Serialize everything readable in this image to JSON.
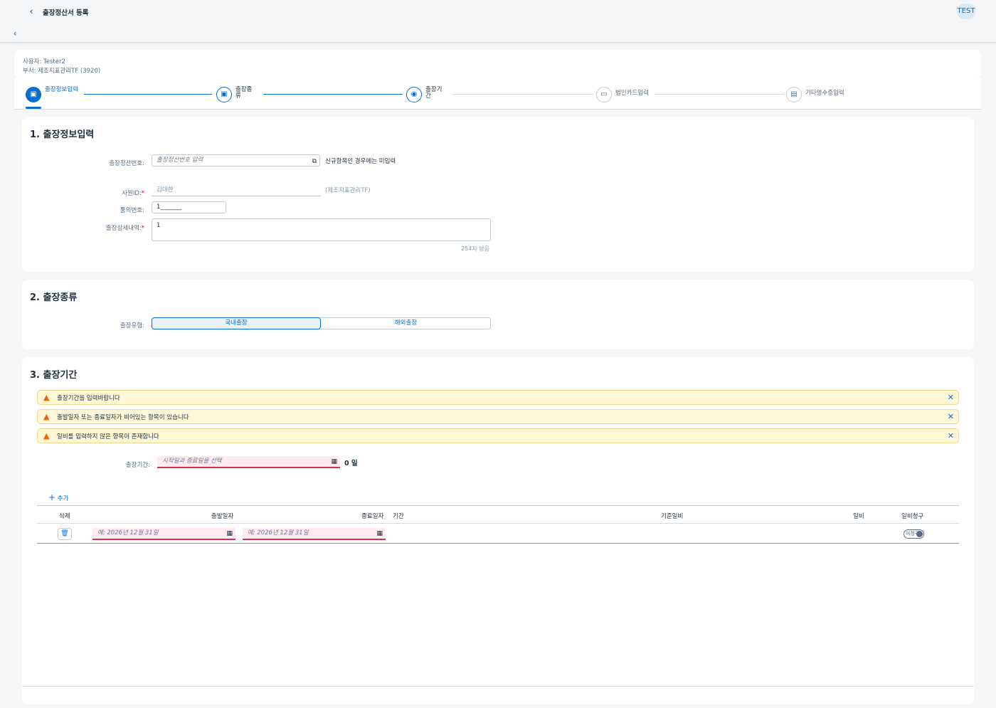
{
  "shell": {
    "title": "출장정산서 등록",
    "avatar": "TEST"
  },
  "header": {
    "user": "사용자: Tester2",
    "department": "부서: 제조지표관리TF (3920)"
  },
  "wizard": {
    "steps": [
      {
        "label": "출장정보입력"
      },
      {
        "label": "출장종류"
      },
      {
        "label": "출장기간"
      },
      {
        "label": "법인카드입력"
      },
      {
        "label": "기타영수증입력"
      }
    ]
  },
  "section1": {
    "title": "1. 출장정보입력",
    "settlement_no_label": "출장정산번호:",
    "settlement_no_placeholder": "출장정산번호 입력",
    "settlement_no_hint": "신규항목인 경우에는 미입력",
    "employee_id_label": "사원ID:",
    "employee_id_value": "김대한",
    "employee_dept_hint": "(제조지표관리TF)",
    "approval_no_label": "품의번호:",
    "approval_no_value": "1_______",
    "detail_label": "출장상세내역:",
    "detail_value": "1",
    "detail_counter": "254자 남음"
  },
  "section2": {
    "title": "2. 출장종류",
    "type_label": "출장유형:",
    "options": [
      "국내출장",
      "해외출장"
    ],
    "selected": "국내출장"
  },
  "section3": {
    "title": "3. 출장기간",
    "messages": [
      "출장기간을 입력바랍니다",
      "출발일자 또는 종료일자가 비어있는 항목이 있습니다",
      "일비를 입력하지 않은 항목이 존재합니다"
    ],
    "period_label": "출장기간:",
    "period_placeholder": "시작일과 종료일을 선택",
    "period_days": "0 일",
    "add_label": "추가",
    "columns": [
      "삭제",
      "출발일자",
      "종료일자",
      "기간",
      "기준일비",
      "일비",
      "일비청구"
    ],
    "rows": [
      {
        "start_placeholder": "예: 2026년 12월 31일",
        "end_placeholder": "예: 2026년 12월 31일",
        "claim_toggle": "미청구"
      }
    ]
  },
  "colors": {
    "accent": "#0a6ed1",
    "warning_bg": "#fff7d6",
    "error_border": "#d9304f"
  },
  "icons": [
    "back-icon",
    "copy-icon",
    "calendar-icon",
    "warning-icon",
    "close-icon",
    "delete-icon",
    "add-icon"
  ]
}
